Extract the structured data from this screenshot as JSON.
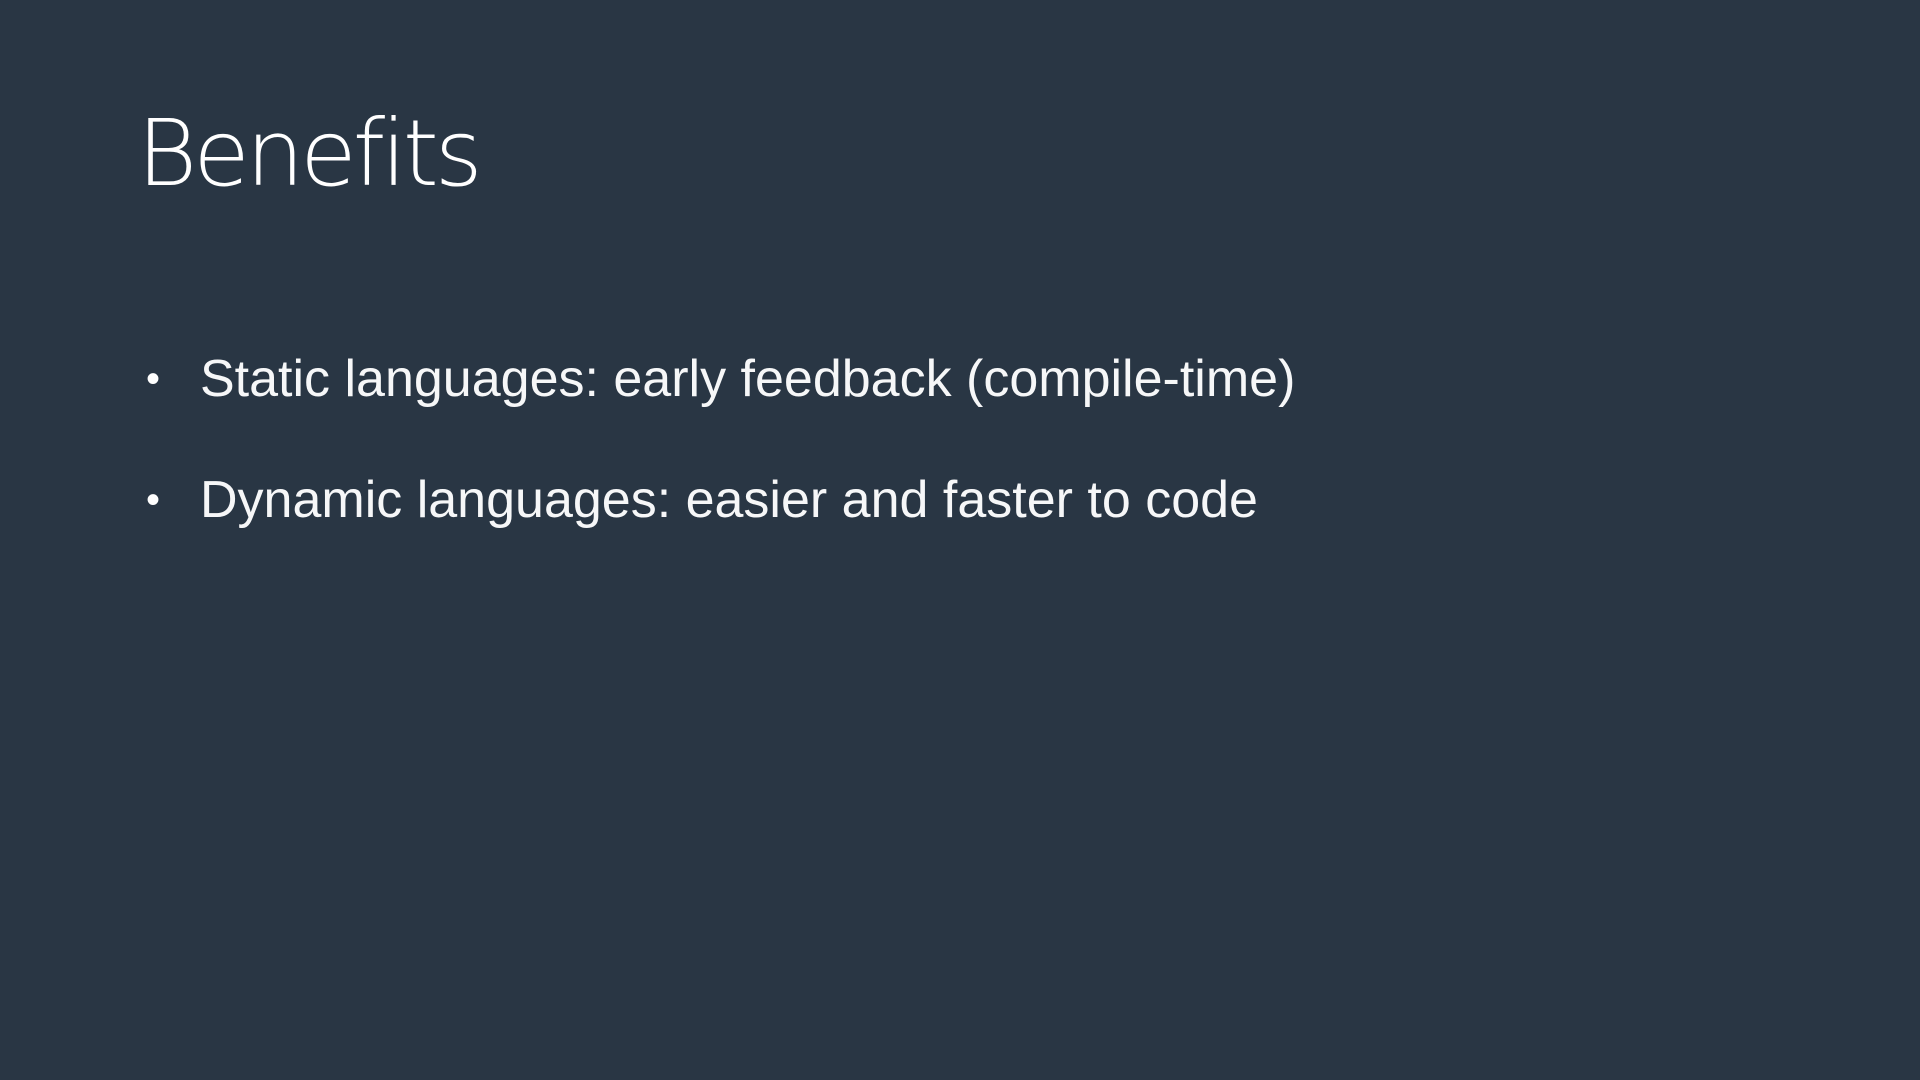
{
  "slide": {
    "title": "Benefits",
    "bullets": [
      "Static languages: early feedback (compile-time)",
      "Dynamic languages: easier and faster to code"
    ],
    "bullet_glyph": "•",
    "colors": {
      "background": "#293644",
      "text": "#ffffff"
    }
  }
}
